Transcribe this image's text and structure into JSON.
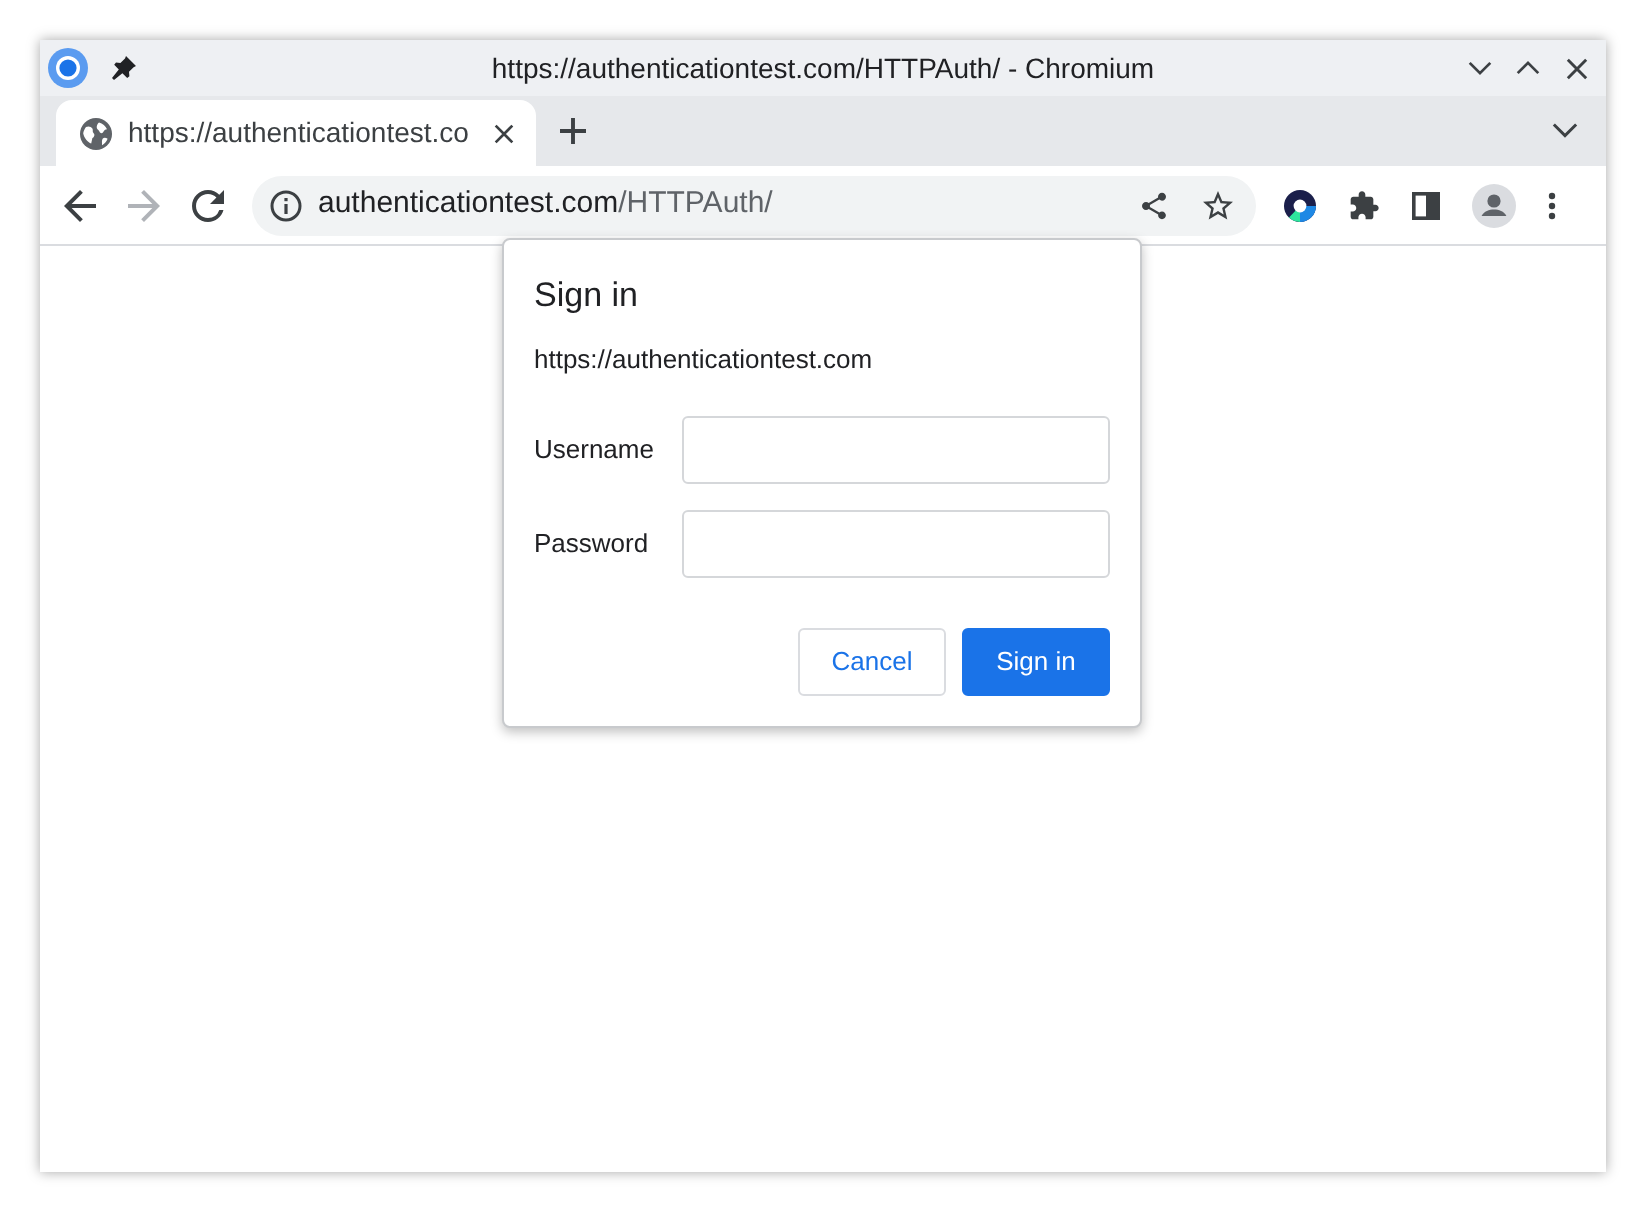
{
  "window": {
    "title": "https://authenticationtest.com/HTTPAuth/ - Chromium"
  },
  "tabs": [
    {
      "title": "https://authenticationtest.co",
      "selected": true
    }
  ],
  "nav_buttons": [
    {
      "kind": "back",
      "disabled": false
    },
    {
      "kind": "forward",
      "disabled": true
    },
    {
      "kind": "reload",
      "disabled": false
    }
  ],
  "address_bar": {
    "host": "authenticationtest.com",
    "path": "/HTTPAuth/"
  },
  "dialog": {
    "title": "Sign in",
    "origin": "https://authenticationtest.com",
    "fields": [
      {
        "label": "Username"
      },
      {
        "label": "Password"
      }
    ],
    "buttons": [
      {
        "label": "Cancel",
        "kind": "secondary"
      },
      {
        "label": "Sign in",
        "kind": "primary"
      }
    ]
  }
}
